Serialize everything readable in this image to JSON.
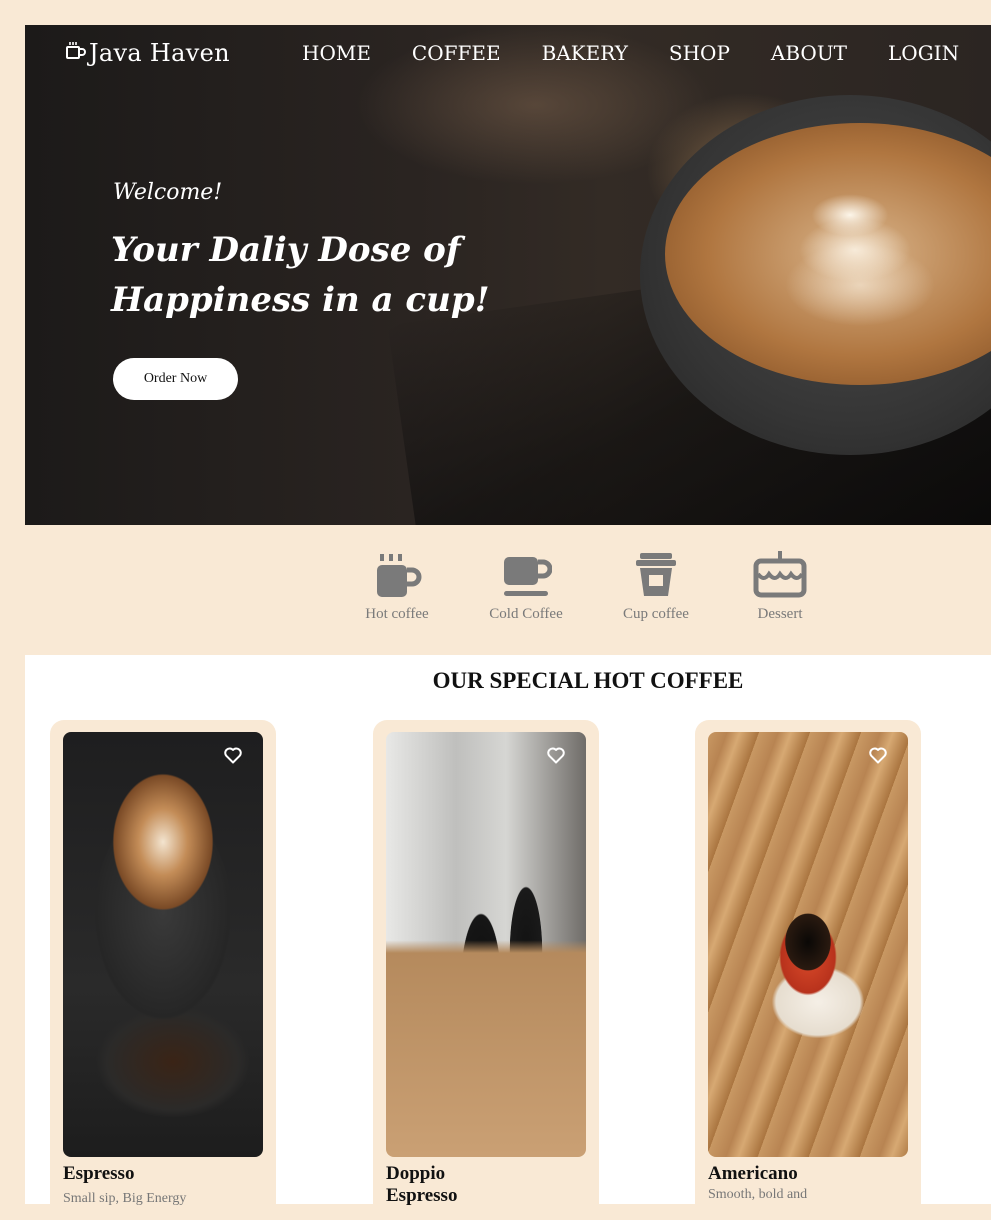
{
  "brand": {
    "name": "Java Haven",
    "icon": "coffee-cup-icon"
  },
  "nav": {
    "items": [
      {
        "label": "HOME"
      },
      {
        "label": "COFFEE"
      },
      {
        "label": "BAKERY"
      },
      {
        "label": "SHOP"
      },
      {
        "label": "ABOUT"
      },
      {
        "label": "LOGIN"
      }
    ]
  },
  "hero": {
    "welcome": "Welcome!",
    "headline": "Your Daliy Dose of Happiness in a cup!",
    "cta_label": "Order Now"
  },
  "categories": [
    {
      "label": "Hot coffee",
      "icon": "hot-mug-icon"
    },
    {
      "label": "Cold Coffee",
      "icon": "mug-saucer-icon"
    },
    {
      "label": "Cup coffee",
      "icon": "takeaway-cup-icon"
    },
    {
      "label": "Dessert",
      "icon": "cake-icon"
    }
  ],
  "special": {
    "title": "OUR SPECIAL HOT COFFEE",
    "products": [
      {
        "name": "Espresso",
        "description": "Small sip, Big Energy",
        "icon": "heart-icon"
      },
      {
        "name": "Doppio Espresso",
        "description": "",
        "icon": "heart-icon"
      },
      {
        "name": "Americano",
        "description": "Smooth, bold and",
        "icon": "heart-icon"
      }
    ]
  },
  "colors": {
    "page_bg": "#f9e9d5",
    "card_bg": "#f9e9d5",
    "icon_gray": "#7a7a7a",
    "hero_text": "#ffffff"
  }
}
